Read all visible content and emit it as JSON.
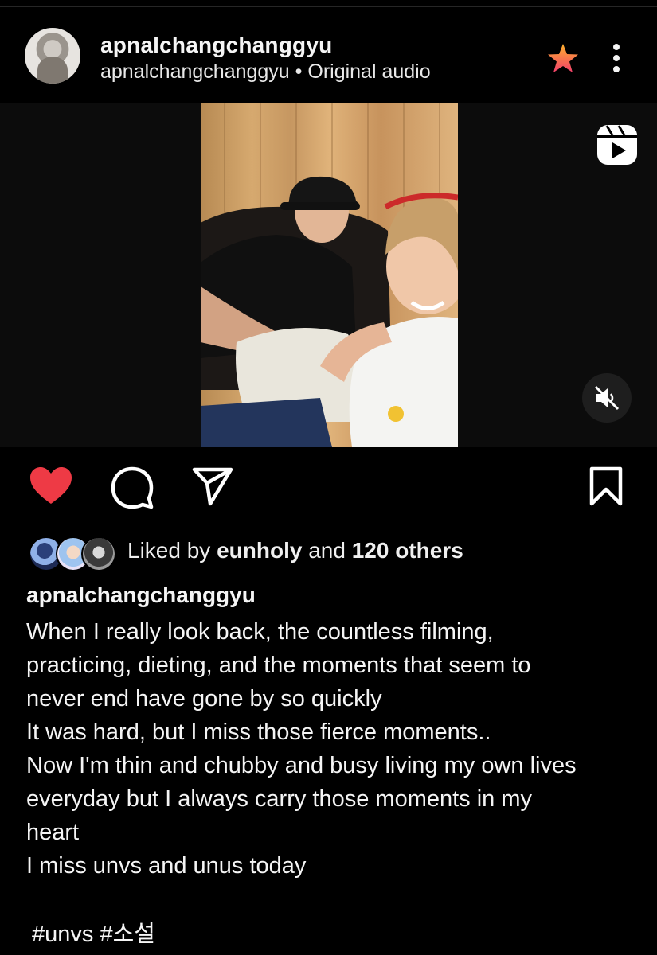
{
  "header": {
    "username": "apnalchangchanggyu",
    "audio_owner": "apnalchangchanggyu",
    "separator": " • ",
    "audio_label": "Original audio"
  },
  "icons": {
    "star": "star-icon",
    "more": "more-vertical-icon",
    "reels": "reels-icon",
    "mute": "muted-speaker-icon",
    "like": "heart-icon",
    "comment": "comment-bubble-icon",
    "share": "paper-plane-icon",
    "save": "bookmark-icon"
  },
  "colors": {
    "background": "#000000",
    "like_red": "#ee3a45",
    "star_gradient_start": "#fdb12d",
    "star_gradient_end": "#f23f6b"
  },
  "likes": {
    "prefix": "Liked by ",
    "user": "eunholy",
    "middle": " and ",
    "others": "120 others"
  },
  "caption": {
    "username": "apnalchangchanggyu",
    "lines": [
      "When I really look back, the countless filming,",
      "practicing, dieting, and the moments that seem to",
      "never end have gone by so quickly",
      "It was hard, but I miss those fierce moments..",
      "Now I'm thin and chubby and busy living my own lives",
      "everyday but I always carry those moments in my",
      "heart",
      "I miss unvs and unus today"
    ],
    "hashtags": "#unvs #소설"
  }
}
